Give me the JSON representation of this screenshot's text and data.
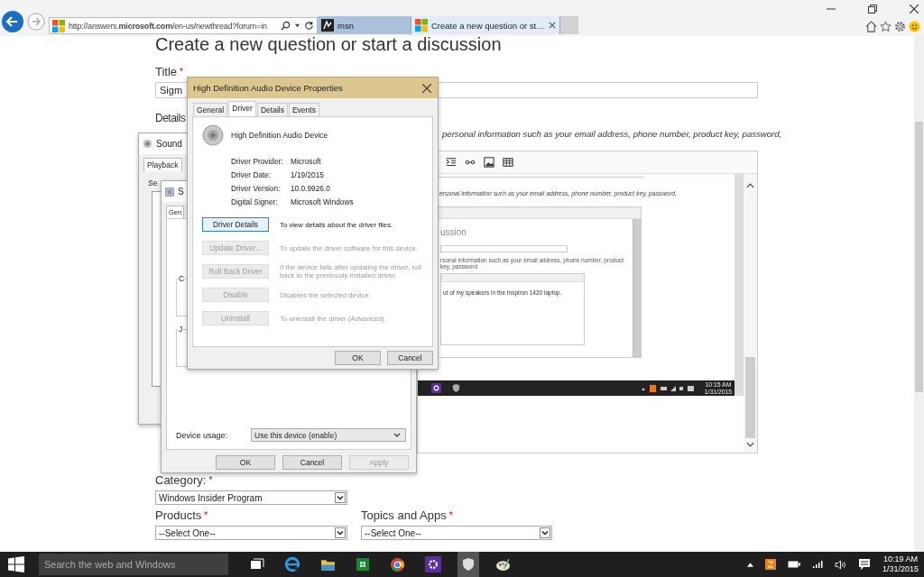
{
  "browser": {
    "address": "http://answers.**microsoft.com**/en-us/newthread?forum=in",
    "tabs": [
      {
        "label": "msn",
        "selected": false
      },
      {
        "label": "Create a new question or st…",
        "selected": true
      }
    ]
  },
  "page": {
    "heading": "Create a new question or start a discussion",
    "title_field": {
      "label": "Title",
      "mark": "*",
      "value": "Sigm"
    },
    "details": {
      "label": "Details",
      "note": "personal information such as your email address, phone number, product key, password,"
    },
    "embedded": {
      "note": "ersonal information such as your email address, phone number, product key, password,",
      "heading": "ussion",
      "inner_note": "rsonal information such as your email address, phone number, product key, password",
      "body": "ut of my speakers in the Inspiron 1420 laptop.",
      "clock_time": "10:15 AM",
      "clock_date": "1/31/2015"
    },
    "category": {
      "label": "Category:",
      "mark": "*",
      "value": "Windows Insider Program"
    },
    "products": {
      "label": "Products",
      "mark": "*",
      "value": "--Select One--"
    },
    "topics": {
      "label": "Topics and Apps",
      "mark": "*",
      "value": "--Select One--"
    }
  },
  "sound_window": {
    "title": "Sound",
    "tab": "Playback",
    "fragment": "Se"
  },
  "speaker_window": {
    "title": "S",
    "tab": "Gen",
    "groups": [
      "C",
      "J"
    ],
    "usage_label": "Device usage:",
    "usage_value": "Use this device (enable)",
    "buttons": [
      {
        "label": "OK",
        "disabled": false
      },
      {
        "label": "Cancel",
        "disabled": false
      },
      {
        "label": "Apply",
        "disabled": true
      }
    ]
  },
  "driver_dialog": {
    "title": "High Definition Audio Device Properties",
    "tabs": [
      {
        "label": "General",
        "selected": false
      },
      {
        "label": "Driver",
        "selected": true
      },
      {
        "label": "Details",
        "selected": false
      },
      {
        "label": "Events",
        "selected": false
      }
    ],
    "device_name": "High Definition Audio Device",
    "info": [
      {
        "label": "Driver Provider:",
        "value": "Microsoft"
      },
      {
        "label": "Driver Date:",
        "value": "1/19/2015"
      },
      {
        "label": "Driver Version:",
        "value": "10.0.9926.0"
      },
      {
        "label": "Digital Signer:",
        "value": "Microsoft Windows"
      }
    ],
    "actions": [
      {
        "label": "Driver Details",
        "description": "To view details about the driver files.",
        "disabled": false
      },
      {
        "label": "Update Driver...",
        "description": "To update the driver software for this device.",
        "disabled": true
      },
      {
        "label": "Roll Back Driver",
        "description": "If the device fails after updating the driver, roll back to the previously installed driver.",
        "disabled": true
      },
      {
        "label": "Disable",
        "description": "Disables the selected device.",
        "disabled": true
      },
      {
        "label": "Uninstall",
        "description": "To uninstall the driver (Advanced).",
        "disabled": true
      }
    ],
    "buttons": [
      "OK",
      "Cancel"
    ]
  },
  "taskbar": {
    "search_placeholder": "Search the web and Windows",
    "time": "10:19 AM",
    "date": "1/31/2015"
  }
}
